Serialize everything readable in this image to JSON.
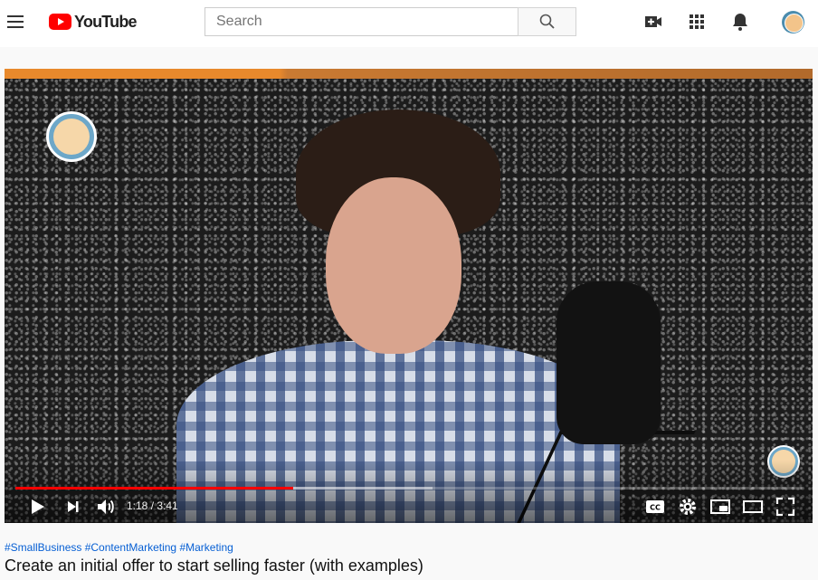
{
  "masthead": {
    "logo_text": "YouTube",
    "search_placeholder": "Search",
    "search_value": "",
    "icons": [
      "menu-icon",
      "search-icon",
      "video-camera-icon",
      "apps-grid-icon",
      "bell-icon"
    ]
  },
  "player": {
    "current_time": "1:18",
    "duration": "3:41",
    "time_display": "1:18 / 3:41",
    "progress_fraction": 0.353,
    "buffered_fraction": 0.53,
    "colors": {
      "played": "#ff0000",
      "orange_strip": "#e8892c"
    }
  },
  "info": {
    "hashtags": [
      "#SmallBusiness",
      "#ContentMarketing",
      "#Marketing"
    ],
    "title": "Create an initial offer to start selling faster (with examples)"
  }
}
